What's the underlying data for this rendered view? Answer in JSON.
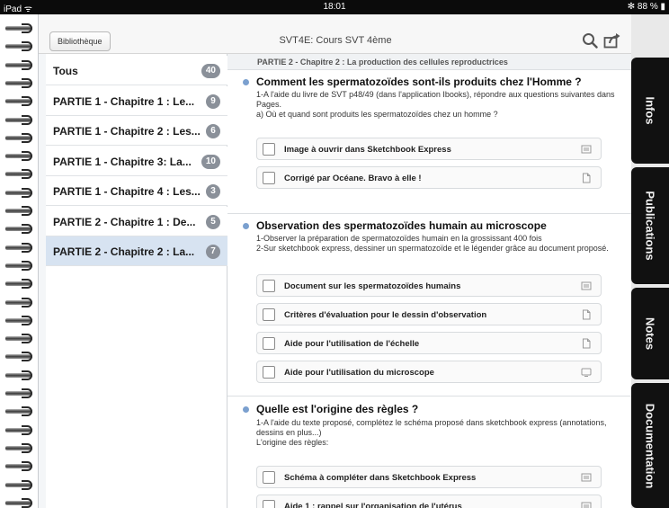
{
  "status_bar": {
    "left": "iPad ᯤ",
    "time": "18:01",
    "right": "✻ 88 % ▮"
  },
  "toolbar": {
    "library_button": "Bibliothèque",
    "title": "SVT4E: Cours SVT 4ème",
    "search_icon": "search-icon",
    "share_icon": "share-icon"
  },
  "sidebar": {
    "items": [
      {
        "label": "Tous",
        "badge": "40"
      },
      {
        "label": "PARTIE 1 - Chapitre 1 : Le...",
        "badge": "9"
      },
      {
        "label": "PARTIE 1 - Chapitre 2 : Les...",
        "badge": "6"
      },
      {
        "label": "PARTIE 1 - Chapitre 3: La...",
        "badge": "10"
      },
      {
        "label": "PARTIE 1 - Chapitre 4 : Les...",
        "badge": "3"
      },
      {
        "label": "PARTIE 2 - Chapitre 1 : De...",
        "badge": "5"
      },
      {
        "label": "PARTIE 2 - Chapitre 2 : La...",
        "badge": "7"
      }
    ],
    "selected_index": 6
  },
  "main": {
    "breadcrumb": "PARTIE 2 - Chapitre 2 : La production des cellules reproductrices",
    "sections": [
      {
        "title": "Comment les spermatozoïdes sont-ils produits chez l'Homme ?",
        "lines": [
          "1-A l'aide du livre de SVT p48/49 (dans l'application Ibooks), répondre aux questions suivantes dans Pages.",
          "a) Où et quand sont produits les spermatozoïdes chez un homme ?"
        ],
        "resources": [
          {
            "label": "Image à ouvrir dans Sketchbook Express",
            "icon": "image-icon"
          },
          {
            "label": "Corrigé par Océane. Bravo à elle !",
            "icon": "document-icon"
          }
        ]
      },
      {
        "title": "Observation des spermatozoïdes humain au microscope",
        "lines": [
          "1-Observer la préparation de spermatozoïdes humain en la grossissant 400 fois",
          "2-Sur sketchbook express, dessiner un spermatozoïde et le légender grâce au document proposé."
        ],
        "resources": [
          {
            "label": "Document sur les spermatozoïdes humains",
            "icon": "image-icon"
          },
          {
            "label": "Critères d'évaluation pour le dessin d'observation",
            "icon": "document-icon"
          },
          {
            "label": "Aide pour l'utilisation de l'échelle",
            "icon": "document-icon"
          },
          {
            "label": "Aide pour l'utilisation du microscope",
            "icon": "video-icon"
          }
        ]
      },
      {
        "title": "Quelle est l'origine des règles ?",
        "lines": [
          "1-A l'aide du texte proposé, complétez le schéma proposé dans sketchbook express (annotations, dessins en plus...)",
          "L'origine des règles:"
        ],
        "resources": [
          {
            "label": "Schéma à compléter dans Sketchbook Express",
            "icon": "image-icon"
          },
          {
            "label": "Aide 1 : rappel sur l'organisation de l'utérus",
            "icon": "image-icon"
          }
        ]
      }
    ]
  },
  "right_tabs": [
    "Infos",
    "Publications",
    "Notes",
    "Documentation"
  ],
  "colors": {
    "selected": "#d7e3f1",
    "badge": "#8a9099",
    "bullet": "#7ba0cf",
    "tab": "#111111"
  }
}
